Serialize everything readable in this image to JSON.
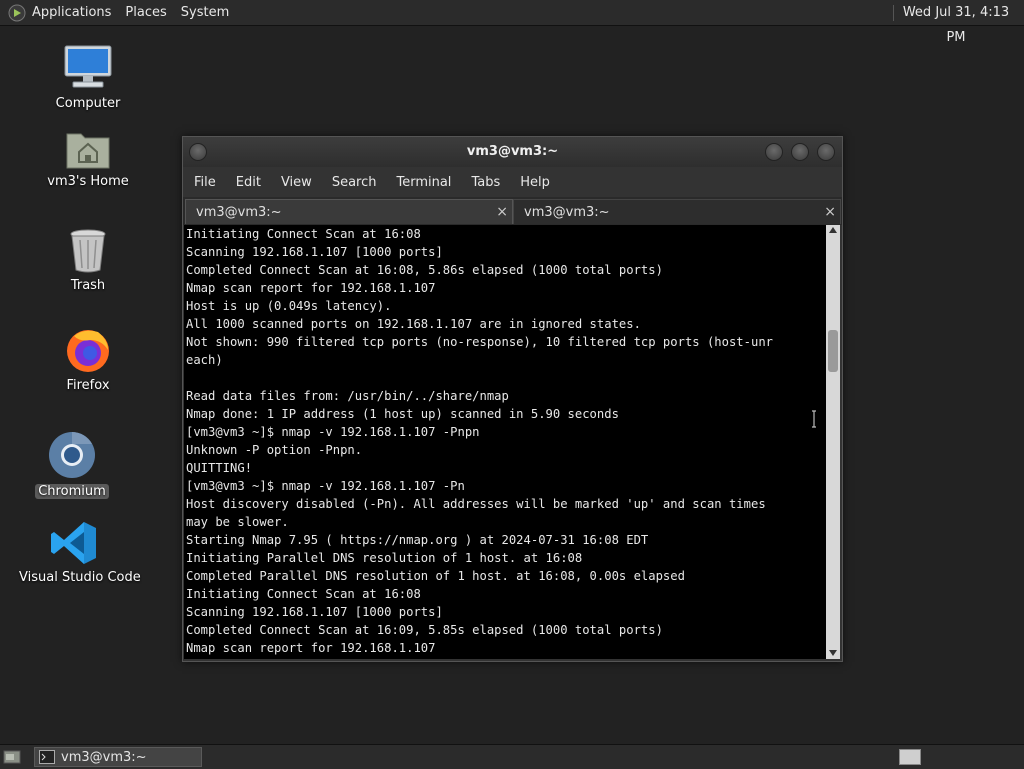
{
  "top_panel": {
    "menus": [
      "Applications",
      "Places",
      "System"
    ],
    "clock": "Wed Jul 31, 4:13 PM"
  },
  "desktop": {
    "icons": [
      {
        "label": "Computer",
        "icon": "computer-icon"
      },
      {
        "label": "vm3's Home",
        "icon": "home-folder-icon"
      },
      {
        "label": "Trash",
        "icon": "trash-icon"
      },
      {
        "label": "Firefox",
        "icon": "firefox-icon"
      },
      {
        "label": "Chromium",
        "icon": "chromium-icon",
        "selected": true
      },
      {
        "label": "Visual Studio Code",
        "icon": "vscode-icon"
      }
    ]
  },
  "terminal": {
    "title": "vm3@vm3:~",
    "menus": [
      "File",
      "Edit",
      "View",
      "Search",
      "Terminal",
      "Tabs",
      "Help"
    ],
    "tabs": [
      {
        "label": "vm3@vm3:~",
        "close": "×",
        "active": true
      },
      {
        "label": "vm3@vm3:~",
        "close": "×",
        "active": false
      }
    ],
    "output": "Initiating Connect Scan at 16:08\nScanning 192.168.1.107 [1000 ports]\nCompleted Connect Scan at 16:08, 5.86s elapsed (1000 total ports)\nNmap scan report for 192.168.1.107\nHost is up (0.049s latency).\nAll 1000 scanned ports on 192.168.1.107 are in ignored states.\nNot shown: 990 filtered tcp ports (no-response), 10 filtered tcp ports (host-unr\neach)\n\nRead data files from: /usr/bin/../share/nmap\nNmap done: 1 IP address (1 host up) scanned in 5.90 seconds\n[vm3@vm3 ~]$ nmap -v 192.168.1.107 -Pnpn\nUnknown -P option -Pnpn.\nQUITTING!\n[vm3@vm3 ~]$ nmap -v 192.168.1.107 -Pn\nHost discovery disabled (-Pn). All addresses will be marked 'up' and scan times\nmay be slower.\nStarting Nmap 7.95 ( https://nmap.org ) at 2024-07-31 16:08 EDT\nInitiating Parallel DNS resolution of 1 host. at 16:08\nCompleted Parallel DNS resolution of 1 host. at 16:08, 0.00s elapsed\nInitiating Connect Scan at 16:08\nScanning 192.168.1.107 [1000 ports]\nCompleted Connect Scan at 16:09, 5.85s elapsed (1000 total ports)\nNmap scan report for 192.168.1.107"
  },
  "taskbar": {
    "task_label": "vm3@vm3:~"
  },
  "colors": {
    "desktop_bg": "#222222",
    "panel_bg": "#2b2b2b",
    "terminal_bg": "#000000",
    "terminal_fg": "#e8e8e8"
  }
}
